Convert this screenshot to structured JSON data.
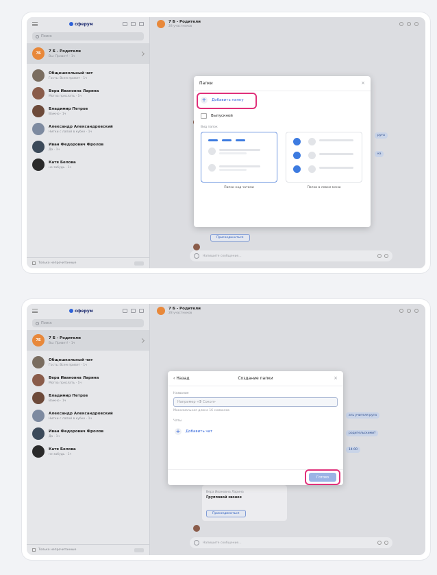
{
  "sidebar": {
    "logo": "сферум",
    "search_placeholder": "Поиск",
    "pinned_chat": {
      "avatar": "7Б",
      "name": "7 Б - Родители",
      "sub": "Вы: Привет! · 1ч"
    },
    "chats": [
      {
        "name": "Общешкольный чат",
        "sub": "Гость: Всем привет · 1ч"
      },
      {
        "name": "Вера Ивановна Ларина",
        "sub": "Могла прислать · 1ч"
      },
      {
        "name": "Владимир Петров",
        "sub": "Важно · 1ч"
      },
      {
        "name": "Александр Александровский",
        "sub": "Нитки с лапой в кубке · 1ч"
      },
      {
        "name": "Иван Федорович Фролов",
        "sub": "Да · 1ч"
      },
      {
        "name": "Катя Белова",
        "sub": "не забудь · 1ч"
      }
    ],
    "footer": "Только непрочитанные"
  },
  "header": {
    "title": "7 Б - Родители",
    "sub": "28 участников"
  },
  "composer": {
    "placeholder": "Напишите сообщение..."
  },
  "bubbles": {
    "top_a": "рута",
    "top_b": "ка",
    "bottom_a": "ать учителя рута",
    "bottom_b": "родительскими?",
    "bottom_c": "14:00",
    "join": "Присоединиться"
  },
  "dialog1": {
    "title": "Папки",
    "add_folder": "Добавить папку",
    "folder_name": "Выпускной",
    "view_label": "Вид папок",
    "view_top": "Папки над чатами",
    "view_left": "Папки в левом меню"
  },
  "dialog2": {
    "back": "Назад",
    "title": "Создание папки",
    "name_label": "Название",
    "name_placeholder": "Например «Ф Сокол»",
    "name_hint": "Максимальная длина 16 символов",
    "chats_label": "Чаты",
    "add_chat": "Добавить чат",
    "done": "Готово",
    "behind_name": "Вера Ивановна Ларина",
    "behind_text": "Групповой звонок",
    "behind_join": "Присоединиться"
  },
  "colors": {
    "accent": "#2e62d9",
    "highlight": "#e0307a",
    "orange": "#e8883a"
  }
}
